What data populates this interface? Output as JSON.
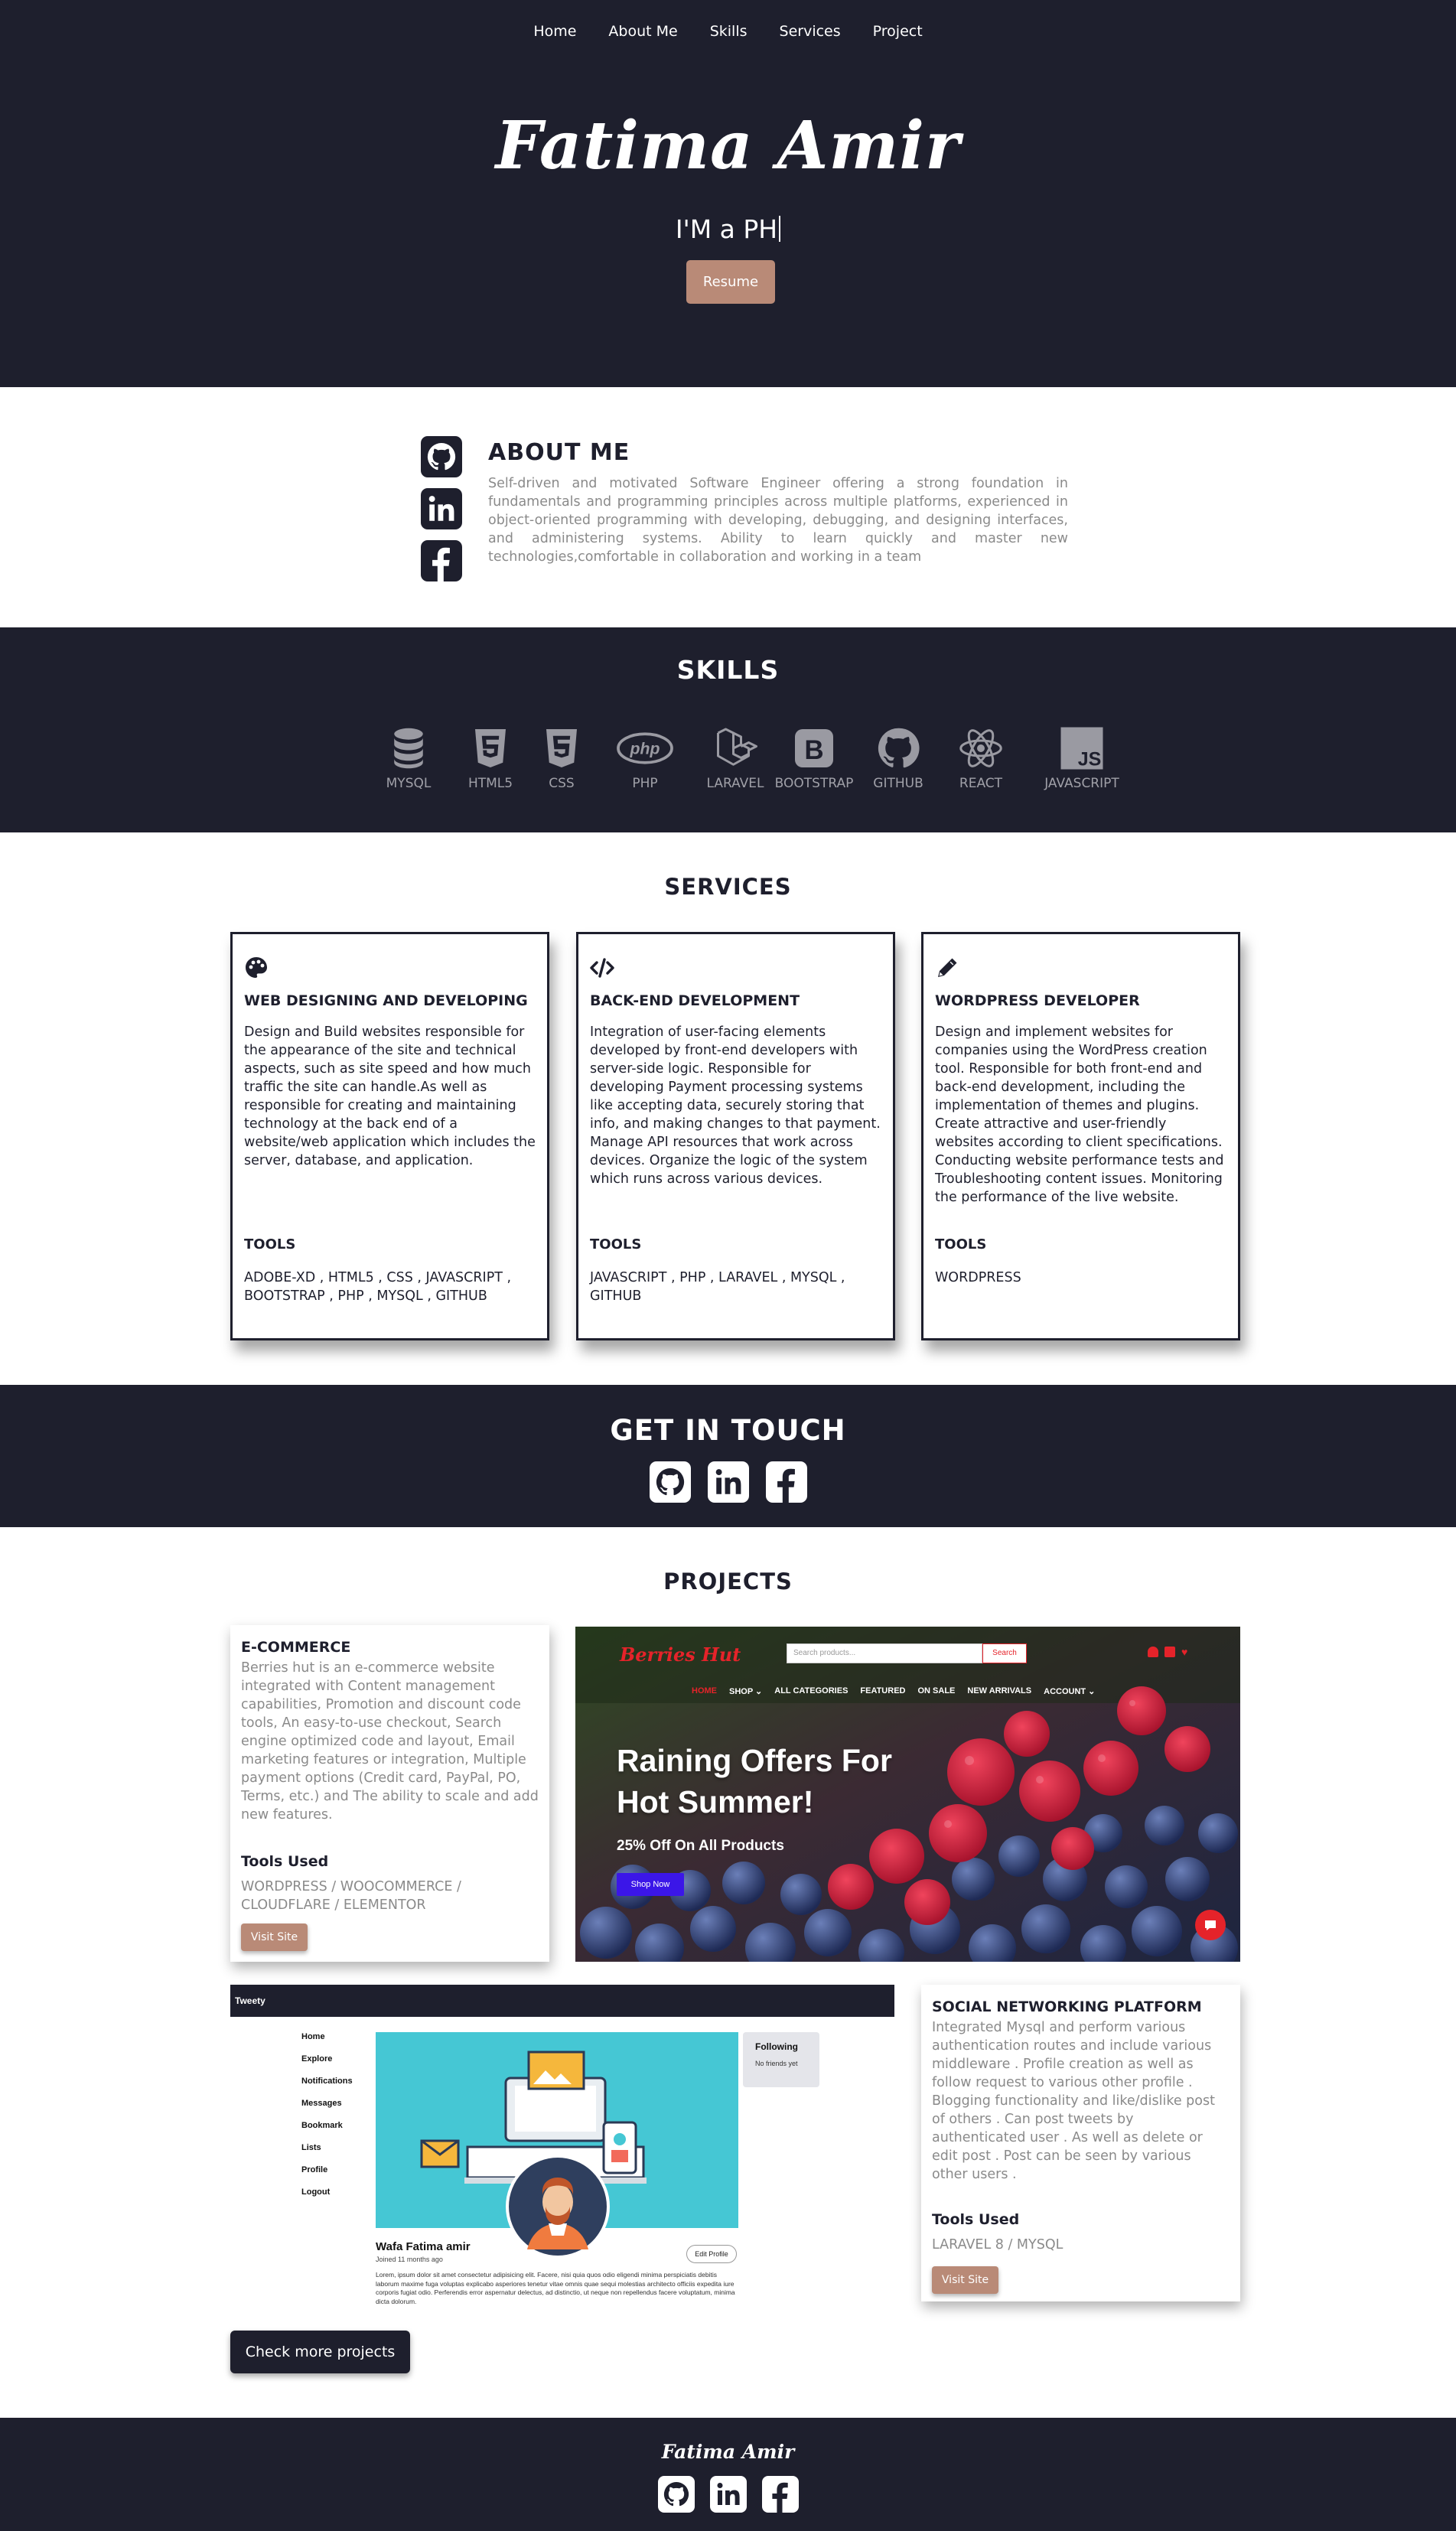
{
  "nav": [
    "Home",
    "About Me",
    "Skills",
    "Services",
    "Project"
  ],
  "hero": {
    "name": "Fatima Amir",
    "typed_text": "I'M a PH",
    "resume_label": "Resume"
  },
  "about": {
    "title": "ABOUT ME",
    "text": "Self-driven and motivated Software Engineer offering a strong foundation in fundamentals and programming principles across multiple platforms, experienced in object-oriented programming with developing, debugging, and designing interfaces, and administering systems. Ability to learn quickly and master new technologies,comfortable in collaboration and working in a team",
    "icons": [
      "github-icon",
      "linkedin-icon",
      "facebook-icon"
    ]
  },
  "skills": {
    "title": "SKILLS",
    "items": [
      {
        "label": "MYSQL",
        "icon": "database-icon"
      },
      {
        "label": "HTML5",
        "icon": "html5-icon"
      },
      {
        "label": "CSS",
        "icon": "css3-icon"
      },
      {
        "label": "PHP",
        "icon": "php-icon"
      },
      {
        "label": "LARAVEL",
        "icon": "laravel-icon"
      },
      {
        "label": "BOOTSTRAP",
        "icon": "bootstrap-icon"
      },
      {
        "label": "GITHUB",
        "icon": "github-icon"
      },
      {
        "label": "REACT",
        "icon": "react-icon"
      },
      {
        "label": "JAVASCRIPT",
        "icon": "javascript-icon"
      }
    ]
  },
  "services": {
    "title": "SERVICES",
    "tools_heading": "TOOLS",
    "cards": [
      {
        "icon": "palette-icon",
        "title": "WEB DESIGNING AND DEVELOPING",
        "text": "Design and Build websites responsible for the appearance of the site and technical aspects, such as site speed and how much traffic the site can handle.As well as responsible for creating and maintaining technology at the back end of a website/web application which includes the server, database, and application.",
        "tools": "ADOBE-XD , HTML5 , CSS , JAVASCRIPT , BOOTSTRAP , PHP , MYSQL , GITHUB"
      },
      {
        "icon": "code-icon",
        "title": "BACK-END DEVELOPMENT",
        "text": "Integration of user-facing elements developed by front-end developers with server-side logic. Responsible for developing Payment processing systems like accepting data, securely storing that info, and making changes to that payment. Manage API resources that work across devices. Organize the logic of the system which runs across various devices.",
        "tools": "JAVASCRIPT , PHP , LARAVEL , MYSQL , GITHUB"
      },
      {
        "icon": "pencil-icon",
        "title": "WORDPRESS DEVELOPER",
        "text": "Design and implement websites for companies using the WordPress creation tool. Responsible for both front-end and back-end development, including the implementation of themes and plugins. Create attractive and user-friendly websites according to client specifications. Conducting website performance tests and Troubleshooting content issues. Monitoring the performance of the live website.",
        "tools": "WORDPRESS"
      }
    ]
  },
  "touch": {
    "title": "GET IN TOUCH"
  },
  "projects": {
    "title": "PROJECTS",
    "tools_heading": "Tools Used",
    "visit_label": "Visit Site",
    "check_more_label": "Check more projects",
    "ecommerce": {
      "title": "E-COMMERCE",
      "text": "Berries hut is an e-commerce website integrated with Content management capabilities, Promotion and discount code tools, An easy-to-use checkout, Search engine optimized code and layout, Email marketing features or integration, Multiple payment options (Credit card, PayPal, PO, Terms, etc.) and The ability to scale and add new features.",
      "tools": "WORDPRESS / WOOCOMMERCE / CLOUDFLARE / ELEMENTOR"
    },
    "social": {
      "title": "SOCIAL NETWORKING PLATFORM",
      "text": "Integrated Mysql and perform various authentication routes and include various middleware . Profile creation as well as follow request to various other profile . Blogging functionality and like/dislike post of others . Can post tweets by authenticated user . As well as delete or edit post . Post can be seen by various other users .",
      "tools": "LARAVEL 8 / MYSQL"
    },
    "berries_screenshot": {
      "logo": "Berries Hut",
      "search_placeholder": "Search products...",
      "search_button": "Search",
      "menu": [
        "HOME",
        "SHOP ⌄",
        "ALL CATEGORIES",
        "FEATURED",
        "ON SALE",
        "NEW ARRIVALS",
        "ACCOUNT ⌄"
      ],
      "headline_1": "Raining Offers For",
      "headline_2": "Hot Summer!",
      "subline": "25% Off On All Products",
      "shop_button": "Shop Now"
    },
    "tweety_screenshot": {
      "brand": "Tweety",
      "menu": [
        "Home",
        "Explore",
        "Notifications",
        "Messages",
        "Bookmark",
        "Lists",
        "Profile",
        "Logout"
      ],
      "following_title": "Following",
      "following_text": "No friends yet",
      "profile_name": "Wafa Fatima amir",
      "joined": "Joined 11 months ago",
      "edit_button": "Edit Profile",
      "bio": "Lorem, ipsum dolor sit amet consectetur adipisicing elit. Facere, nisi quia quos odio eligendi minima perspiciatis debitis laborum maxime fuga voluptas explicabo asperiores tenetur vitae omnis quae sequi molestias architecto officiis expedita iure corporis fugiat odio. Perferendis error aspernatur delectus, ad distinctio, ut neque non repellendus facere voluptatum, minima dicta dolorum."
    }
  },
  "footer": {
    "name": "Fatima Amir"
  },
  "colors": {
    "dark": "#1e1f2d",
    "accent": "#b98a77",
    "muted_text": "#8a8a8a"
  }
}
